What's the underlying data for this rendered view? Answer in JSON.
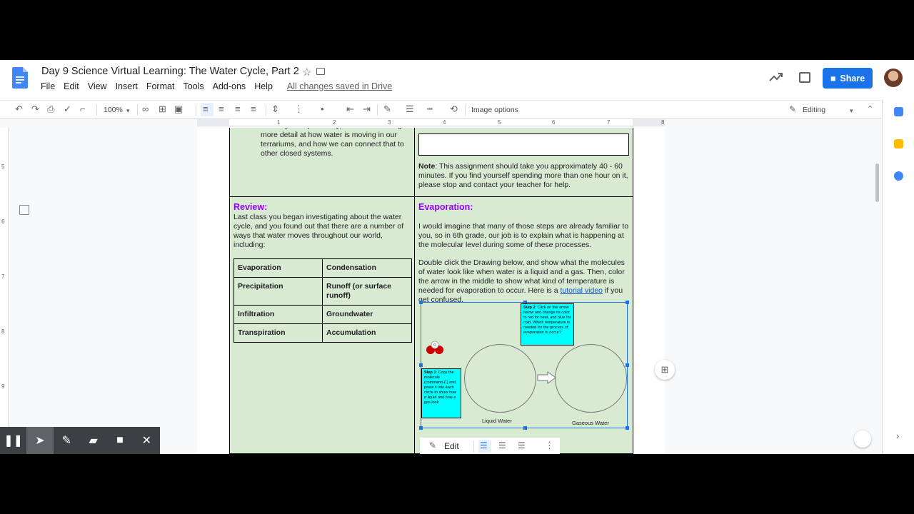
{
  "header": {
    "title": "Day 9 Science Virtual Learning: The Water Cycle, Part 2",
    "menu": [
      "File",
      "Edit",
      "View",
      "Insert",
      "Format",
      "Tools",
      "Add-ons",
      "Help"
    ],
    "saved_status": "All changes saved in Drive",
    "share_label": "Share"
  },
  "toolbar": {
    "zoom": "100%",
    "image_options": "Image options",
    "mode": "Editing"
  },
  "ruler": {
    "h_marks": [
      "1",
      "2",
      "3",
      "4",
      "5",
      "6",
      "7",
      "8"
    ],
    "v_marks": [
      "5",
      "6",
      "7",
      "8",
      "9"
    ]
  },
  "document": {
    "top_left_text": "water cycle. Specifically, we will be looking in more detail at how water is moving in our terrariums, and how we can connect that to other closed systems.",
    "note_label": "Note",
    "note_text": ": This assignment should take you approximately 40 - 60 minutes. If you find yourself spending more than one hour on it, please stop and contact your teacher for help.",
    "review": {
      "heading": "Review:",
      "body": "Last class you began investigating about the water cycle, and you found out that there are a number of ways that water moves throughout our world, including:",
      "terms": [
        [
          "Evaporation",
          "Condensation"
        ],
        [
          "Precipitation",
          "Runoff (or surface runoff)"
        ],
        [
          "Infiltration",
          "Groundwater"
        ],
        [
          "Transpiration",
          "Accumulation"
        ]
      ]
    },
    "evaporation": {
      "heading": "Evaporation:",
      "para1": "I would imagine that many of those steps are already familiar to you, so in 6th grade, our job is to explain what is happening at the molecular level during some of these processes.",
      "para2": "Double click the Drawing below, and show what the molecules of water look like when water is a liquid and a gas. Then, color the arrow in the middle to show what kind of temperature is needed for evaporation to occur. Here is a ",
      "link": "tutorial video",
      "para2_end": " if you get confused."
    },
    "drawing": {
      "step1_label": "Step 1",
      "step1": ": Copy the molecule (command-C) and paste it into each circle to show how a liquid and how a gas look",
      "step2_label": "Step 2",
      "step2": ": Click on the arrow below and change its color to red for heat, and blue for cold. Which temperature is needed for the process of evaporation to occur?",
      "liquid_label": "Liquid Water",
      "gas_label": "Gaseous Water",
      "molecule_label": "O"
    }
  },
  "image_toolbar": {
    "edit_label": "Edit"
  },
  "colors": {
    "share_blue": "#1a73e8",
    "cell_green": "#d9ead3",
    "heading_purple": "#9900ff",
    "step_cyan": "#00ffff"
  }
}
